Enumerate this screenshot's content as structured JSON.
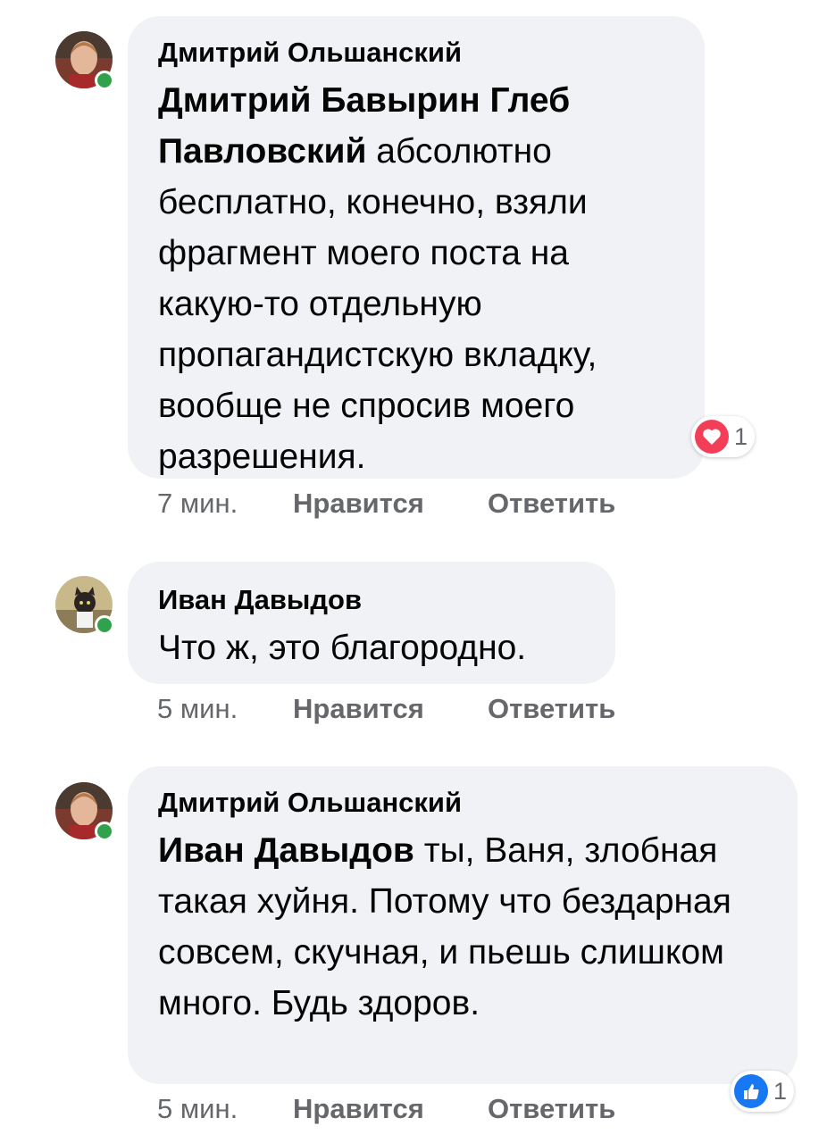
{
  "comments": [
    {
      "author": "Дмитрий Ольшанский",
      "mention": "Дмитрий Бавырин Глеб Павловский",
      "text": " абсолютно бесплатно, конечно, взяли фрагмент моего поста на какую-то отдельную пропагандистскую вкладку, вообще не спросив моего разрешения.",
      "time": "7 мин.",
      "like_label": "Нравится",
      "reply_label": "Ответить",
      "reaction": {
        "icon": "heart-icon",
        "count": "1",
        "color": "#f33e58"
      }
    },
    {
      "author": "Иван Давыдов",
      "mention": "",
      "text": "Что ж, это благородно.",
      "time": "5 мин.",
      "like_label": "Нравится",
      "reply_label": "Ответить"
    },
    {
      "author": "Дмитрий Ольшанский",
      "mention": "Иван Давыдов",
      "text": " ты, Ваня, злобная такая хуйня. Потому что бездарная совсем, скучная, и пьешь слишком много. Будь здоров.",
      "time": "5 мин.",
      "like_label": "Нравится",
      "reply_label": "Ответить",
      "reaction": {
        "icon": "thumbs-up-icon",
        "count": "1",
        "color": "#1877f2"
      }
    }
  ],
  "colors": {
    "bubble": "#f0f2f5",
    "online": "#31a24c",
    "meta": "#65676b"
  }
}
